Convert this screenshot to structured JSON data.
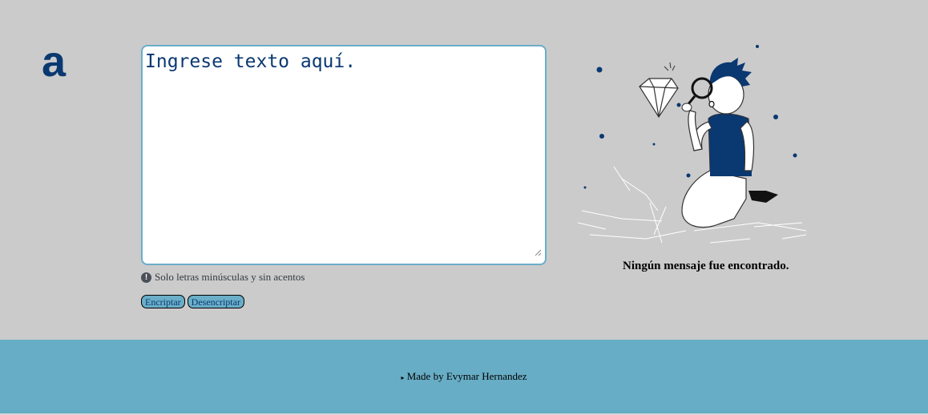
{
  "brand": {
    "logo_text": "a",
    "color": "#0a3871"
  },
  "input": {
    "placeholder": "Ingrese texto aquí.",
    "value": ""
  },
  "hint": {
    "icon": "info-circle-icon",
    "text": "Solo letras minúsculas y sin acentos"
  },
  "actions": {
    "encrypt_label": "Encriptar",
    "decrypt_label": "Desencriptar"
  },
  "result": {
    "empty_title": "Ningún mensaje fue encontrado."
  },
  "footer": {
    "credit": "Made by Evymar Hernandez"
  },
  "colors": {
    "background": "#cbcbcb",
    "accent": "#67adc5",
    "primary": "#0a3871"
  }
}
